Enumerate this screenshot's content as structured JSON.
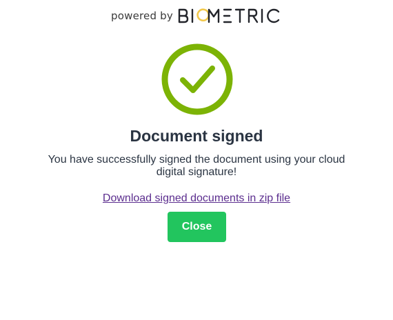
{
  "header": {
    "powered_by": "powered by",
    "brand": "BIOMETRIC"
  },
  "status": {
    "icon": "checkmark-circle-icon",
    "color": "#7cb305"
  },
  "title": "Document signed",
  "message": "You have successfully signed the document using your cloud digital signature!",
  "download_link": "Download signed documents in zip file",
  "close_button": "Close",
  "colors": {
    "success_green": "#22c55e",
    "link_purple": "#5b2d8e",
    "brand_accent": "#f2c94c"
  }
}
